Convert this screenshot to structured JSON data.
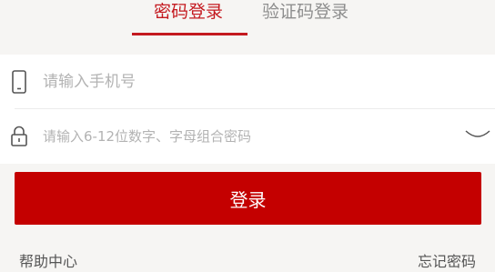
{
  "tabs": {
    "password_login": "密码登录",
    "sms_login": "验证码登录"
  },
  "form": {
    "phone_placeholder": "请输入手机号",
    "password_placeholder": "请输入6-12位数字、字母组合密码",
    "phone_icon": "phone-icon",
    "password_icon": "lock-icon",
    "password_toggle_icon": "eye-closed-icon"
  },
  "login_button": "登录",
  "links": {
    "help_center": "帮助中心",
    "forgot_password": "忘记密码"
  },
  "colors": {
    "accent": "#c4191f",
    "button": "#c40000",
    "background": "#f6f5f3"
  }
}
